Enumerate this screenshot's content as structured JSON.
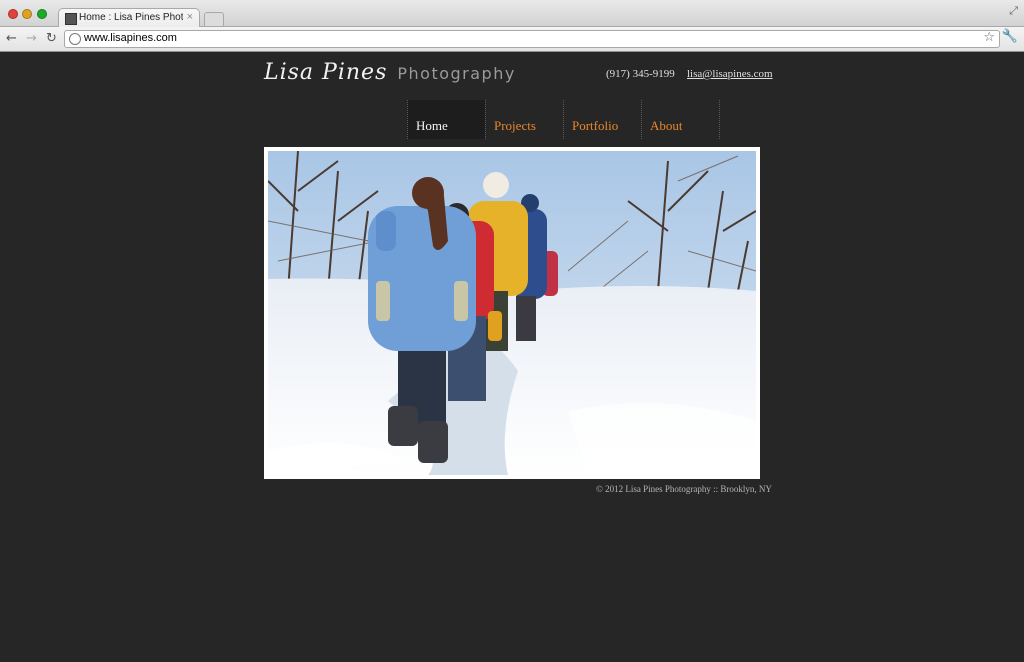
{
  "browser": {
    "tab_title": "Home : Lisa Pines Photography",
    "tab_close": "×",
    "url": "www.lisapines.com",
    "icons": [
      "back-icon",
      "forward-icon",
      "reload-icon",
      "globe-icon",
      "star-icon",
      "wrench-icon",
      "resize-icon"
    ]
  },
  "site": {
    "logo_name": "Lisa Pines",
    "logo_sub": "Photography",
    "phone": "(917) 345-9199",
    "email": "lisa@lisapines.com",
    "menu": [
      {
        "label": "Home",
        "active": true
      },
      {
        "label": "Projects",
        "active": false
      },
      {
        "label": "Portfolio",
        "active": false
      },
      {
        "label": "About",
        "active": false
      }
    ],
    "footer": "© 2012 Lisa Pines Photography :: Brooklyn, NY",
    "colors": {
      "background": "#262626",
      "menu_link": "#e8862b",
      "menu_active_bg": "#1d1d1d"
    }
  }
}
